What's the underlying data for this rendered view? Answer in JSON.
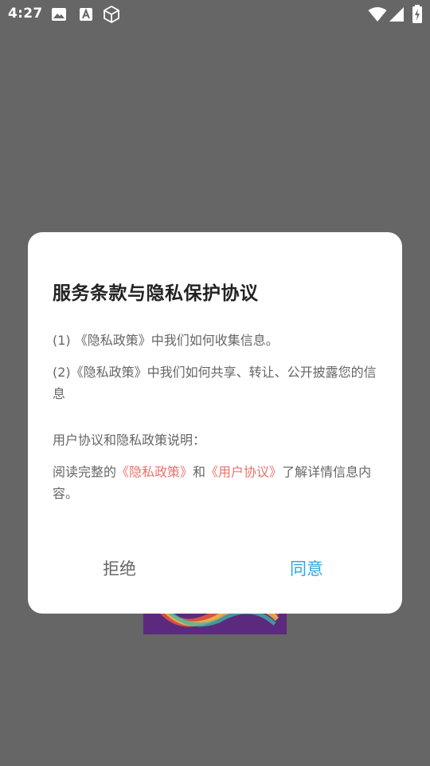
{
  "status_bar": {
    "time": "4:27",
    "icons": [
      "image-icon",
      "font-icon",
      "cube-icon",
      "wifi-icon",
      "signal-icon",
      "battery-charging-icon"
    ]
  },
  "dialog": {
    "title": "服务条款与隐私保护协议",
    "item1": "(1) 《隐私政策》中我们如何收集信息。",
    "item2": "(2)《隐私政策》中我们如何共享、转让、公开披露您的信息",
    "section_heading": "用户协议和隐私政策说明：",
    "read_prefix": "阅读完整的",
    "privacy_link": "《隐私政策》",
    "read_and": "和",
    "user_link": "《用户协议》",
    "read_suffix": "了解详情信息内容。",
    "refuse_label": "拒绝",
    "agree_label": "同意"
  },
  "colors": {
    "overlay": "#666666",
    "link": "#e9726b",
    "agree": "#2ea9df",
    "text": "#666666",
    "title": "#222222"
  }
}
